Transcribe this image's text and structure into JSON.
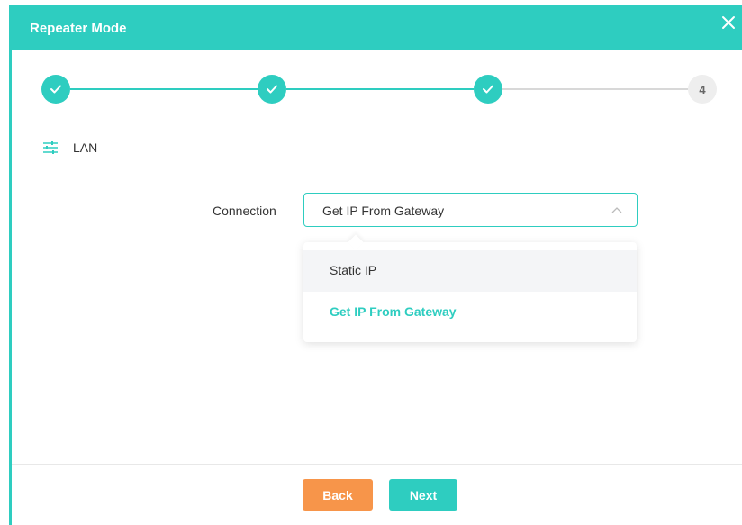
{
  "dialog": {
    "title": "Repeater Mode"
  },
  "stepper": {
    "steps": [
      {
        "state": "done",
        "icon": "check-icon"
      },
      {
        "state": "done",
        "icon": "check-icon"
      },
      {
        "state": "done",
        "icon": "check-icon"
      },
      {
        "state": "current",
        "label": "4"
      }
    ]
  },
  "section": {
    "icon": "sliders-icon",
    "title": "LAN"
  },
  "connection": {
    "label": "Connection",
    "selected": "Get IP From Gateway",
    "options": [
      "Static IP",
      "Get IP From Gateway"
    ]
  },
  "footer": {
    "back_label": "Back",
    "next_label": "Next"
  },
  "colors": {
    "accent": "#2ecdc0",
    "back_button": "#f7954a",
    "inactive_step": "#eeeeee"
  }
}
